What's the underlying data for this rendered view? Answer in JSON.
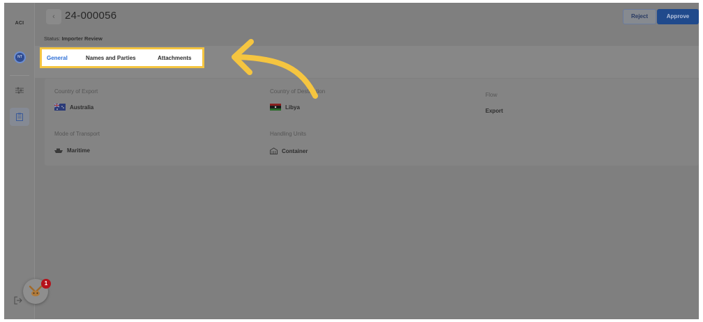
{
  "sidebar": {
    "logo": "ACI",
    "avatar": "NT",
    "nav": [
      {
        "icon": "sliders-icon"
      },
      {
        "icon": "clipboard-icon",
        "active": true
      }
    ],
    "exit_icon": "logout-icon"
  },
  "header": {
    "back_label": "‹",
    "title": "24-000056",
    "reject_label": "Reject",
    "approve_label": "Approve"
  },
  "status": {
    "label": "Status:",
    "value": "Importer Review"
  },
  "tabs": [
    {
      "label": "General",
      "active": true
    },
    {
      "label": "Names and Parties",
      "active": false
    },
    {
      "label": "Attachments",
      "active": false
    }
  ],
  "details": {
    "country_of_export": {
      "label": "Country of Export",
      "value": "Australia"
    },
    "country_of_destination": {
      "label": "Country of Destination",
      "value": "Libya"
    },
    "flow": {
      "label": "Flow",
      "value": "Export"
    },
    "mode_of_transport": {
      "label": "Mode of Transport",
      "value": "Maritime"
    },
    "handling_units": {
      "label": "Handling Units",
      "value": "Container"
    }
  },
  "widget": {
    "badge_count": "1"
  },
  "colors": {
    "highlight": "#f5c540",
    "accent": "#2d6fd6",
    "approve": "#204a8c",
    "badge": "#b5121b"
  }
}
